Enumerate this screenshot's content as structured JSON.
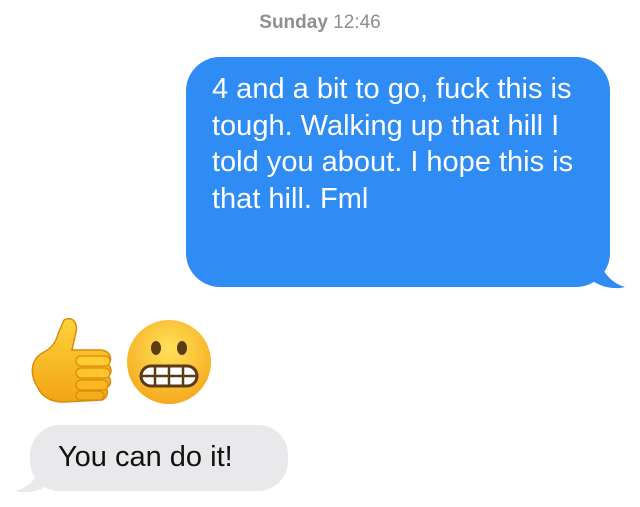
{
  "conversation": {
    "timestamp_day": "Sunday",
    "timestamp_time": "12:46",
    "sent_message": "4 and a bit  to go, fuck this is tough. Walking up that hill I told you about. I hope this is that hill. Fml",
    "received_message": "You can do it!",
    "reaction_emojis": [
      "thumbs-up-icon",
      "grimacing-face-icon"
    ]
  },
  "colors": {
    "sent_bubble": "#2f8cf5",
    "received_bubble": "#e9e9eb",
    "timestamp": "#8e8e93"
  }
}
